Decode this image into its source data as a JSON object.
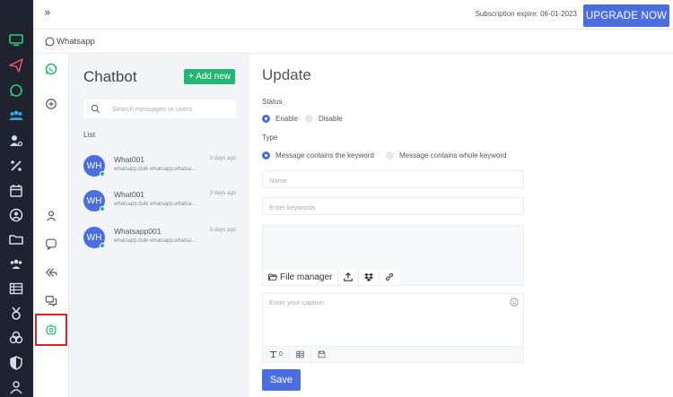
{
  "header": {
    "collapse_icon": "»",
    "subscription": "Subscription expire: 06-01-2023",
    "upgrade_label": "UPGRADE NOW"
  },
  "breadcrumb": {
    "title": "Whatsapp"
  },
  "rail": {
    "items": [
      "monitor-icon",
      "send-icon",
      "whatsapp-icon",
      "users-icon",
      "user-settings-icon",
      "percent-icon",
      "calendar-icon",
      "user-circle-icon",
      "folder-icon",
      "group-icon",
      "table-icon",
      "award-icon",
      "bitcoin-icon",
      "shield-icon",
      "profile-icon"
    ],
    "accent_active": "#e9536b"
  },
  "sidebar2": {
    "items": [
      "whatsapp-icon",
      "add-circle-icon",
      "contact-icon",
      "chat-bubble-icon",
      "reply-all-icon",
      "conversation-icon",
      "chatbot-icon"
    ],
    "active": "chatbot-icon"
  },
  "chatbot": {
    "title": "Chatbot",
    "add_label": "+ Add new",
    "search_placeholder": "Search messages or users",
    "list_label": "List",
    "items": [
      {
        "avatar": "WH",
        "name": "What001",
        "time": "3 days ago",
        "preview": "whatsapp,bulk whatsapp,whatsa..."
      },
      {
        "avatar": "WH",
        "name": "What001",
        "time": "3 days ago",
        "preview": "whatsapp,bulk whatsapp,whatsa..."
      },
      {
        "avatar": "WH",
        "name": "Whatsapp001",
        "time": "3 days ago",
        "preview": "whatsapp,bulk whatsapp,whatsa..."
      }
    ]
  },
  "form": {
    "title": "Update",
    "status_label": "Status",
    "status_options": [
      "Enable",
      "Disable"
    ],
    "status_selected": "Enable",
    "type_label": "Type",
    "type_options": [
      "Message contains the keyword",
      "Message contains whole keyword"
    ],
    "type_selected": "Message contains the keyword",
    "name_placeholder": "Name",
    "keywords_placeholder": "Enter keywords",
    "file_manager_label": "File manager",
    "caption_placeholder": "Enter your caption",
    "caption_counter": "0",
    "save_label": "Save"
  },
  "colors": {
    "primary": "#4a6ee0",
    "green": "#22b573",
    "rail": "#1f2330",
    "highlight": "#e02424"
  }
}
